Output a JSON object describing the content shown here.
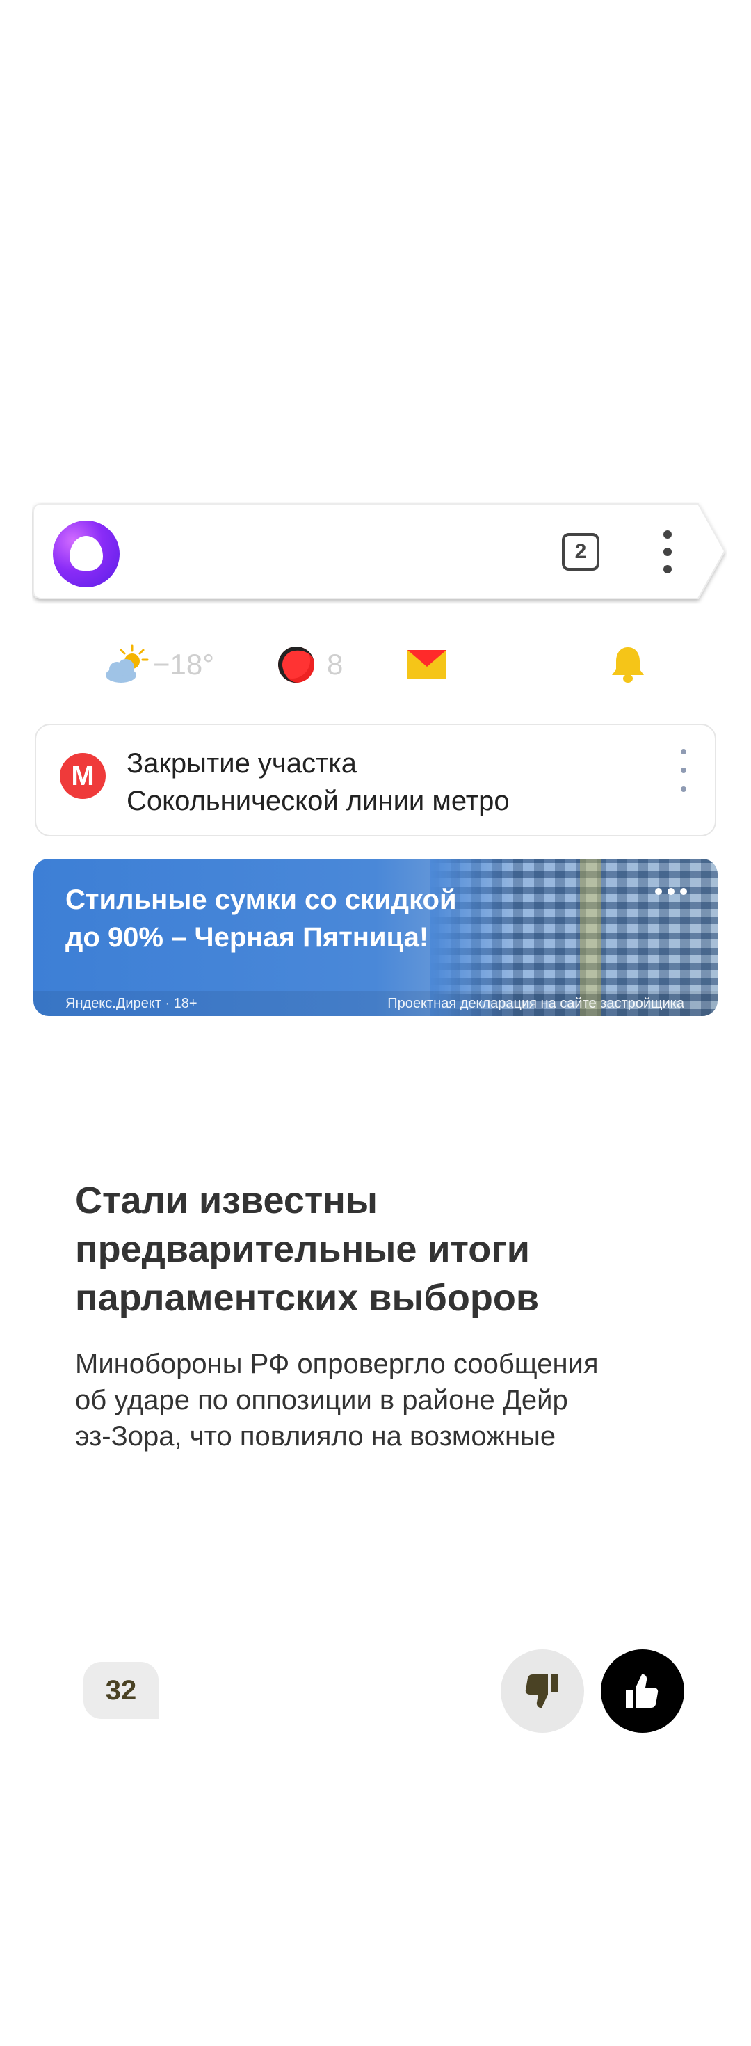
{
  "searchbar": {
    "assistant_icon": "alice-icon",
    "tabs_count": "2",
    "menu_icon": "more-vertical-icon"
  },
  "informers": {
    "weather": {
      "icon": "partly-cloudy-icon",
      "temperature": "−18°"
    },
    "traffic": {
      "icon": "traffic-icon",
      "score": "8"
    },
    "mail": {
      "icon": "mail-icon",
      "color": "#f5c518"
    },
    "notifications": {
      "icon": "bell-icon",
      "color": "#f5c518"
    }
  },
  "alert": {
    "icon": "metro-icon",
    "logo_letter": "М",
    "line1": "Закрытие участка",
    "line2": "Сокольнической линии метро"
  },
  "ad": {
    "title_line1": "Стильные сумки со скидкой",
    "title_line2": "до 90% – Черная Пятница!",
    "label": "Яндекс.Директ · 18+",
    "disclaimer": "Проектная декларация на сайте застройщика"
  },
  "news": {
    "title_line1": "Стали известны",
    "title_line2": "предварительные итоги",
    "title_line3": "парламентских выборов",
    "text_line1": "Минобороны РФ опровергло сообщения",
    "text_line2": "об ударе по оппозиции в районе Дейр",
    "text_line3": "эз-Зора, что повлияло на возможные"
  },
  "reactions": {
    "comments_count": "32",
    "dislike_icon": "thumbs-down-icon",
    "like_icon": "thumbs-up-icon"
  },
  "colors": {
    "accent_purple": "#8a2cf7",
    "metro_red": "#ef3a3a",
    "ad_blue": "#3d7fd6",
    "yellow": "#f5c518"
  }
}
